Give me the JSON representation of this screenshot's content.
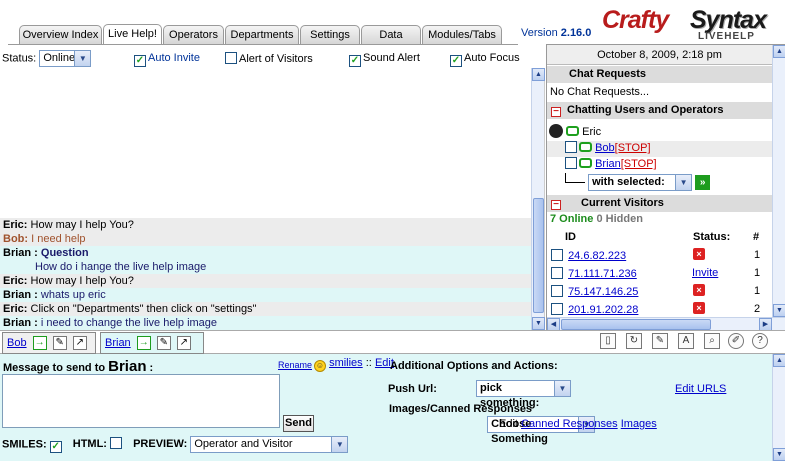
{
  "tabs": [
    "Overview Index",
    "Live Help!",
    "Operators",
    "Departments",
    "Settings",
    "Data",
    "Modules/Tabs"
  ],
  "active_tab": "Live Help!",
  "version_label": "Version",
  "version": "2.16.0",
  "logo": {
    "crafty": "Crafty",
    "syntax": "Syntax",
    "sub": "LIVEHELP"
  },
  "status": {
    "label": "Status:",
    "value": "Online",
    "auto_invite": "Auto Invite",
    "alert_visitors": "Alert of Visitors",
    "sound_alert": "Sound Alert",
    "auto_focus": "Auto Focus"
  },
  "chat": [
    {
      "name": "Eric:",
      "text": "How may I help You?"
    },
    {
      "name": "Bob:",
      "text": "I need help"
    },
    {
      "name": "Brian :",
      "text": "Question"
    },
    {
      "name": "",
      "text": "How do i hange the live help image"
    },
    {
      "name": "Eric:",
      "text": "How may I help You?"
    },
    {
      "name": "Brian :",
      "text": "whats up eric"
    },
    {
      "name": "Eric:",
      "text": "Click on \"Departments\" then click on \"settings\""
    },
    {
      "name": "Brian :",
      "text": "i need to change the live help image"
    }
  ],
  "right": {
    "date": "October 8, 2009, 2:18 pm",
    "chat_requests_title": "Chat Requests",
    "no_requests": "No Chat Requests...",
    "chatting_title": "Chatting Users and Operators",
    "operator": "Eric",
    "users": [
      "Bob",
      "Brian"
    ],
    "stop_label": "[STOP]",
    "with_selected": "with selected:",
    "current_visitors_title": "Current Visitors",
    "online_count": "7 Online",
    "hidden_count": "0 Hidden",
    "col_id": "ID",
    "col_status": "Status:",
    "col_num": "#",
    "visitors": [
      {
        "ip": "24.6.82.223",
        "status": "",
        "count": "1"
      },
      {
        "ip": "71.111.71.236",
        "status": "Invite",
        "count": "1"
      },
      {
        "ip": "75.147.146.25",
        "status": "",
        "count": "1"
      },
      {
        "ip": "201.91.202.28",
        "status": "",
        "count": "2"
      }
    ]
  },
  "channels": [
    "Bob",
    "Brian"
  ],
  "compose": {
    "message_label": "Message to send to",
    "recipient": "Brian",
    "colon": ":",
    "rename": "Rename",
    "smilies": "smilies",
    "sep": "::",
    "edit": "Edit",
    "additional": "Additional Options and Actions:",
    "push_url_label": "Push Url:",
    "push_url_value": "pick something:",
    "edit_urls": "Edit URLS",
    "images_label": "Images/Canned Responses",
    "canned_value": "Choose Something",
    "edit_prefix": "Edit",
    "canned_link": "Canned Responses",
    "images_link": "Images",
    "send": "Send",
    "smiles_label": "SMILES:",
    "html_label": "HTML:",
    "preview_label": "PREVIEW:",
    "preview_value": "Operator and Visitor"
  }
}
